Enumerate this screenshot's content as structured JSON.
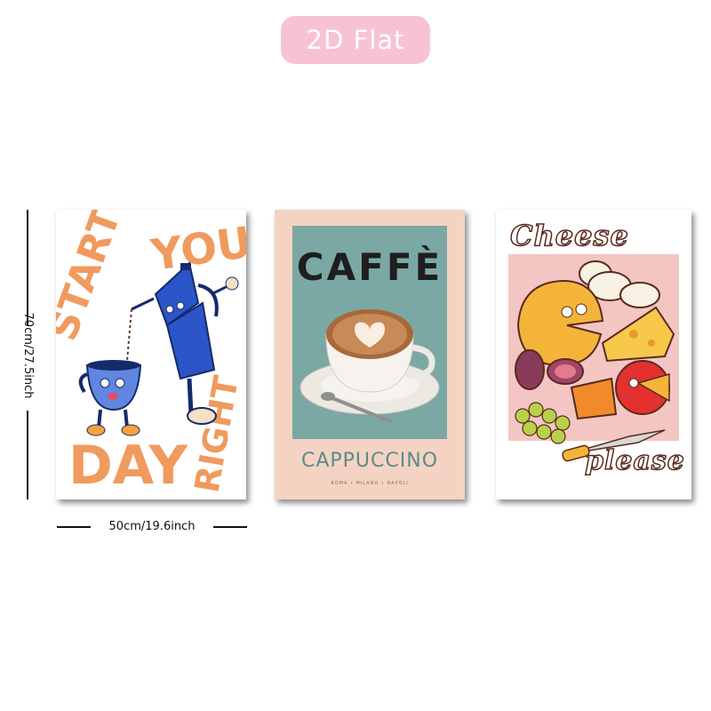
{
  "badge": {
    "label": "2D Flat"
  },
  "dimensions": {
    "width_label": "50cm/19.6inch",
    "height_label": "70cm/27.5inch"
  },
  "posters": [
    {
      "words": [
        "START",
        "YOUR",
        "DAY",
        "RIGHT"
      ]
    },
    {
      "title": "CAFFÈ",
      "subtitle": "CAPPUCCINO",
      "footer": "ROMA • MILANO • NAPOLI"
    },
    {
      "title": "Cheese",
      "subtitle": "please"
    }
  ],
  "colors": {
    "badge_bg": "#f7c3d4",
    "orange": "#f09a5e",
    "blue": "#2b55c8",
    "teal": "#7ba8a4",
    "peach": "#f4d3c2",
    "cheese_yellow": "#f4b43a",
    "cheese_red": "#e2312e",
    "pink_bg": "#f3c6c4"
  }
}
